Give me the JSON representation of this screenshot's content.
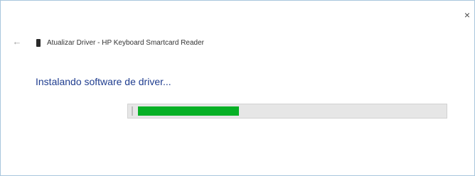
{
  "window": {
    "close_icon": "close-icon",
    "close_glyph": "×"
  },
  "header": {
    "back_icon": "back-arrow-icon",
    "back_glyph": "←",
    "device_icon": "smartcard-reader-icon",
    "title": "Atualizar Driver - HP Keyboard Smartcard Reader"
  },
  "main": {
    "status": "Instalando software de driver..."
  },
  "progress": {
    "value": 0.33,
    "color": "#06b025"
  }
}
